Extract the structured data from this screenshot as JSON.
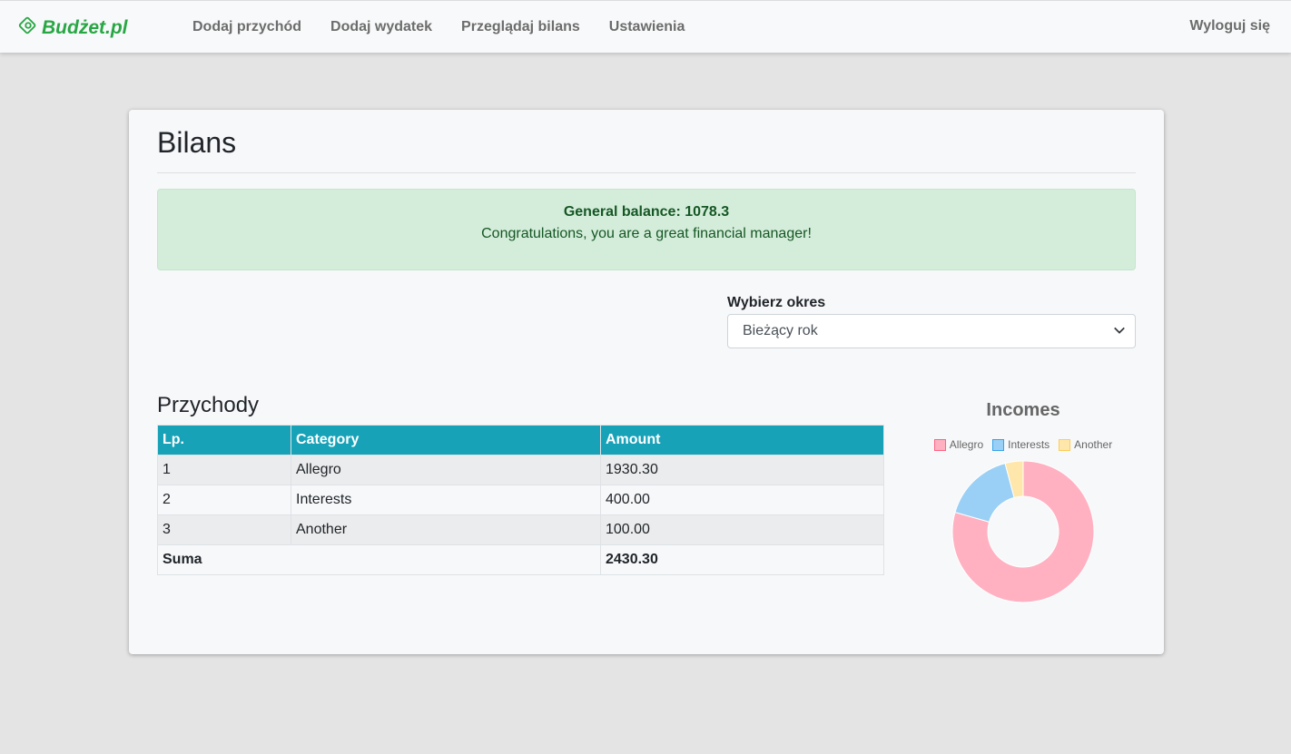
{
  "navbar": {
    "brand": "Budżet.pl",
    "links": [
      "Dodaj przychód",
      "Dodaj wydatek",
      "Przeglądaj bilans",
      "Ustawienia"
    ],
    "logout": "Wyloguj się"
  },
  "page": {
    "title": "Bilans",
    "alert": {
      "balance": "General balance: 1078.3",
      "message": "Congratulations, you are a great financial manager!"
    },
    "period": {
      "label": "Wybierz okres",
      "selected": "Bieżący rok"
    }
  },
  "incomes": {
    "title": "Przychody",
    "headers": [
      "Lp.",
      "Category",
      "Amount"
    ],
    "rows": [
      [
        "1",
        "Allegro",
        "1930.30"
      ],
      [
        "2",
        "Interests",
        "400.00"
      ],
      [
        "3",
        "Another",
        "100.00"
      ]
    ],
    "sum_label": "Suma",
    "sum_value": "2430.30"
  },
  "chart_data": {
    "type": "pie",
    "title": "Incomes",
    "categories": [
      "Allegro",
      "Interests",
      "Another"
    ],
    "values": [
      1930.3,
      400.0,
      100.0
    ],
    "colors": [
      "#ffb1c1",
      "#9ad0f5",
      "#ffe6aa"
    ],
    "border_colors": [
      "#ff6384",
      "#36a2eb",
      "#ffcd56"
    ],
    "legend": "top",
    "donut": true
  }
}
